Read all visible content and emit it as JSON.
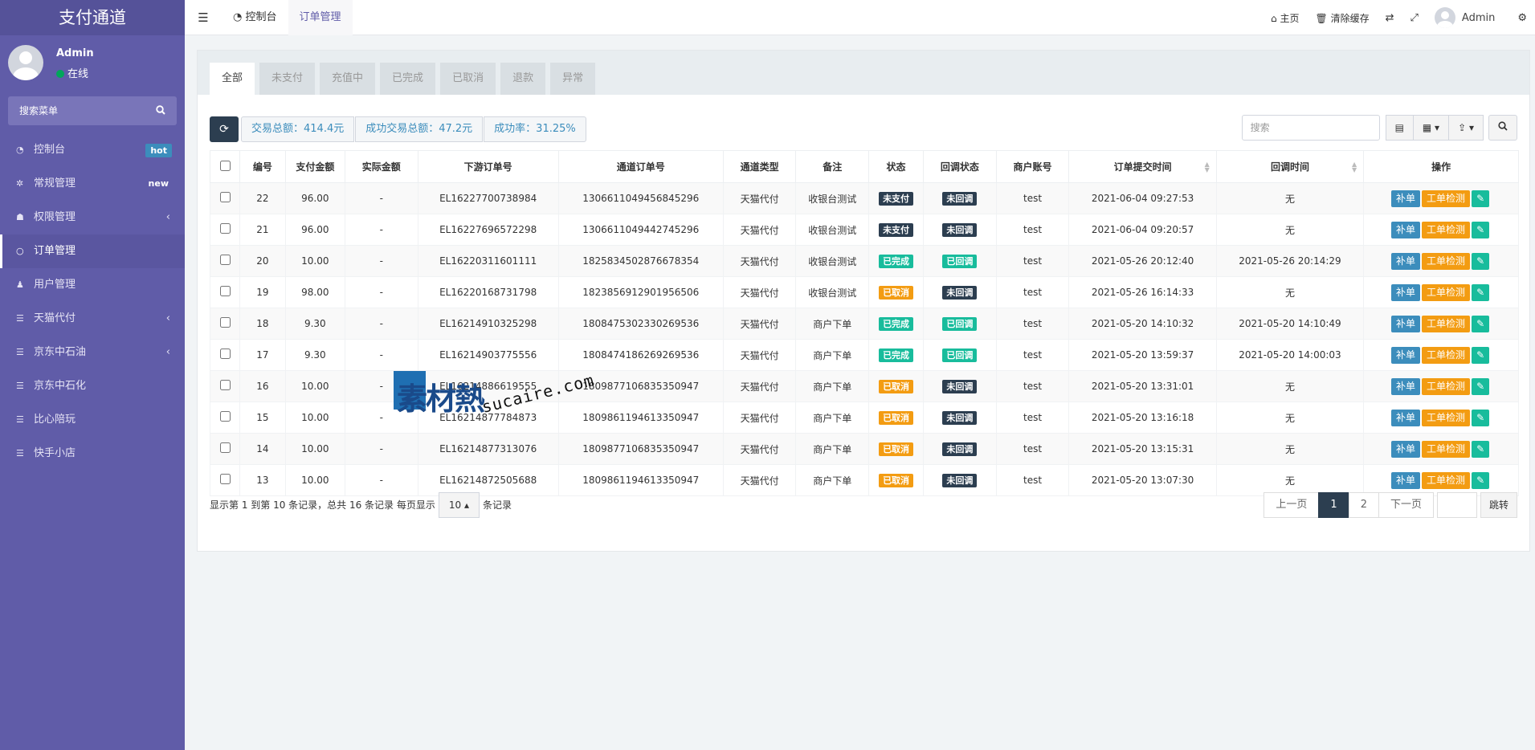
{
  "sidebar": {
    "brand": "支付通道",
    "user": {
      "name": "Admin",
      "status": "在线"
    },
    "search_placeholder": "搜索菜单",
    "items": [
      {
        "label": "控制台",
        "icon": "dashboard-icon",
        "badge": "hot"
      },
      {
        "label": "常规管理",
        "icon": "cogs-icon",
        "badge": "new"
      },
      {
        "label": "权限管理",
        "icon": "group-icon",
        "chevron": true
      },
      {
        "label": "订单管理",
        "icon": "circle-icon",
        "active": true
      },
      {
        "label": "用户管理",
        "icon": "user-icon"
      },
      {
        "label": "天猫代付",
        "icon": "list-icon",
        "chevron": true
      },
      {
        "label": "京东中石油",
        "icon": "list-icon",
        "chevron": true
      },
      {
        "label": "京东中石化",
        "icon": "list-icon"
      },
      {
        "label": "比心陪玩",
        "icon": "list-icon"
      },
      {
        "label": "快手小店",
        "icon": "list-icon"
      }
    ]
  },
  "topbar": {
    "tabs": [
      "控制台",
      "订单管理"
    ],
    "home": "主页",
    "clear_cache": "清除缓存",
    "user": "Admin"
  },
  "status_tabs": [
    "全部",
    "未支付",
    "充值中",
    "已完成",
    "已取消",
    "退款",
    "异常"
  ],
  "stats": {
    "total": "交易总额：414.4元",
    "success_total": "成功交易总额：47.2元",
    "rate": "成功率：31.25%"
  },
  "table_search_placeholder": "搜索",
  "columns": [
    "编号",
    "支付金额",
    "实际金额",
    "下游订单号",
    "通道订单号",
    "通道类型",
    "备注",
    "状态",
    "回调状态",
    "商户账号",
    "订单提交时间",
    "回调时间",
    "操作"
  ],
  "actions": {
    "supplement": "补单",
    "check": "工单检测"
  },
  "rows": [
    {
      "id": "22",
      "amount": "96.00",
      "actual": "-",
      "down": "EL16227700738984",
      "channel": "1306611049456845296",
      "type": "天猫代付",
      "note": "收银台测试",
      "status": "未支付",
      "cb": "未回调",
      "merchant": "test",
      "submit": "2021-06-04 09:27:53",
      "cbtime": "无"
    },
    {
      "id": "21",
      "amount": "96.00",
      "actual": "-",
      "down": "EL16227696572298",
      "channel": "1306611049442745296",
      "type": "天猫代付",
      "note": "收银台测试",
      "status": "未支付",
      "cb": "未回调",
      "merchant": "test",
      "submit": "2021-06-04 09:20:57",
      "cbtime": "无"
    },
    {
      "id": "20",
      "amount": "10.00",
      "actual": "-",
      "down": "EL16220311601111",
      "channel": "1825834502876678354",
      "type": "天猫代付",
      "note": "收银台测试",
      "status": "已完成",
      "cb": "已回调",
      "merchant": "test",
      "submit": "2021-05-26 20:12:40",
      "cbtime": "2021-05-26 20:14:29"
    },
    {
      "id": "19",
      "amount": "98.00",
      "actual": "-",
      "down": "EL16220168731798",
      "channel": "1823856912901956506",
      "type": "天猫代付",
      "note": "收银台测试",
      "status": "已取消",
      "cb": "未回调",
      "merchant": "test",
      "submit": "2021-05-26 16:14:33",
      "cbtime": "无"
    },
    {
      "id": "18",
      "amount": "9.30",
      "actual": "-",
      "down": "EL16214910325298",
      "channel": "1808475302330269536",
      "type": "天猫代付",
      "note": "商户下单",
      "status": "已完成",
      "cb": "已回调",
      "merchant": "test",
      "submit": "2021-05-20 14:10:32",
      "cbtime": "2021-05-20 14:10:49"
    },
    {
      "id": "17",
      "amount": "9.30",
      "actual": "-",
      "down": "EL16214903775556",
      "channel": "1808474186269269536",
      "type": "天猫代付",
      "note": "商户下单",
      "status": "已完成",
      "cb": "已回调",
      "merchant": "test",
      "submit": "2021-05-20 13:59:37",
      "cbtime": "2021-05-20 14:00:03"
    },
    {
      "id": "16",
      "amount": "10.00",
      "actual": "-",
      "down": "EL16214886619555",
      "channel": "1809877106835350947",
      "type": "天猫代付",
      "note": "商户下单",
      "status": "已取消",
      "cb": "未回调",
      "merchant": "test",
      "submit": "2021-05-20 13:31:01",
      "cbtime": "无"
    },
    {
      "id": "15",
      "amount": "10.00",
      "actual": "-",
      "down": "EL16214877784873",
      "channel": "1809861194613350947",
      "type": "天猫代付",
      "note": "商户下单",
      "status": "已取消",
      "cb": "未回调",
      "merchant": "test",
      "submit": "2021-05-20 13:16:18",
      "cbtime": "无"
    },
    {
      "id": "14",
      "amount": "10.00",
      "actual": "-",
      "down": "EL16214877313076",
      "channel": "1809877106835350947",
      "type": "天猫代付",
      "note": "商户下单",
      "status": "已取消",
      "cb": "未回调",
      "merchant": "test",
      "submit": "2021-05-20 13:15:31",
      "cbtime": "无"
    },
    {
      "id": "13",
      "amount": "10.00",
      "actual": "-",
      "down": "EL16214872505688",
      "channel": "1809861194613350947",
      "type": "天猫代付",
      "note": "商户下单",
      "status": "已取消",
      "cb": "未回调",
      "merchant": "test",
      "submit": "2021-05-20 13:07:30",
      "cbtime": "无"
    }
  ],
  "status_colors": {
    "未支付": "#2c3e50",
    "已完成": "#18bc9c",
    "已取消": "#f39c12",
    "未回调": "#2c3e50",
    "已回调": "#18bc9c"
  },
  "footer": {
    "info_prefix": "显示第 1 到第 10 条记录，总共 16 条记录 每页显示",
    "page_size": "10",
    "info_suffix": "条记录",
    "prev": "上一页",
    "pages": [
      "1",
      "2"
    ],
    "next": "下一页",
    "jump": "跳转"
  },
  "watermark": {
    "cn": "素材熱",
    "en": "sucaire.com"
  }
}
